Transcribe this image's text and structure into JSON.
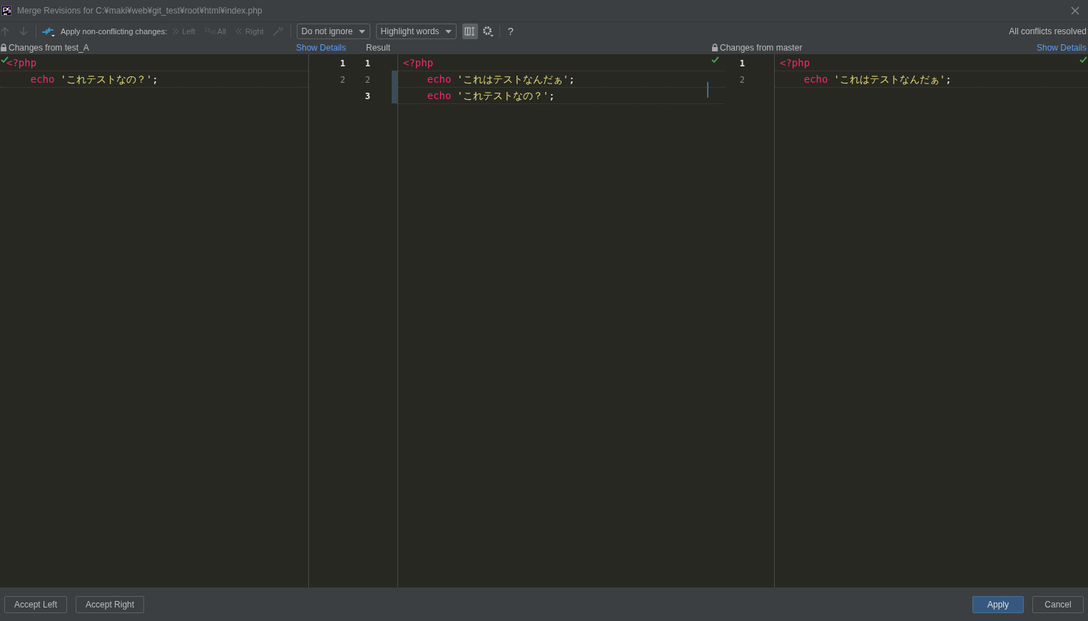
{
  "window": {
    "title": "Merge Revisions for C:¥maki¥web¥git_test¥root¥html¥index.php"
  },
  "toolbar": {
    "nav": [
      {
        "kind": "up",
        "disabled": true
      },
      {
        "kind": "down",
        "disabled": true
      }
    ],
    "apply_label": "Apply non-conflicting changes:",
    "apply_buttons": [
      {
        "kind": "left",
        "label": "Left",
        "disabled": true
      },
      {
        "kind": "all",
        "label": "All",
        "disabled": true
      },
      {
        "kind": "right",
        "label": "Right",
        "disabled": true
      }
    ],
    "dropdowns": [
      "Do not ignore",
      "Highlight words"
    ],
    "sync_scroll": {
      "on": true
    },
    "help": "?",
    "status": "All conflicts resolved"
  },
  "panes": [
    {
      "kind": "side",
      "header": "Changes from test_A",
      "link": "Show Details",
      "resolved": true,
      "line_numbers": [
        {
          "text": "1",
          "current": true
        },
        {
          "text": "2",
          "current": false
        }
      ],
      "lines": [
        {
          "tokens": [
            {
              "kind": "tag",
              "text": "<?php"
            }
          ]
        },
        {
          "tokens": [
            {
              "kind": "keyword",
              "text": "    echo"
            },
            {
              "kind": "string",
              "text": "'これテストなの？'"
            },
            {
              "kind": "punct",
              "text": ";"
            }
          ]
        }
      ]
    },
    {
      "kind": "result",
      "header": "Result",
      "resolved": true,
      "line_numbers": [
        {
          "text": "1",
          "current": true
        },
        {
          "text": "2",
          "current": false
        },
        {
          "text": "3",
          "current": true
        }
      ],
      "lines": [
        {
          "tokens": [
            {
              "kind": "tag",
              "text": "<?php"
            }
          ]
        },
        {
          "tokens": [
            {
              "kind": "keyword",
              "text": "    echo"
            },
            {
              "kind": "string",
              "text": "'これはテストなんだぁ'"
            },
            {
              "kind": "punct",
              "text": ";"
            }
          ]
        },
        {
          "tokens": [
            {
              "kind": "keyword",
              "text": "    echo"
            },
            {
              "kind": "string",
              "text": "'これテストなの？'"
            },
            {
              "kind": "punct",
              "text": ";"
            }
          ]
        }
      ]
    },
    {
      "kind": "side",
      "header": "Changes from master",
      "link": "Show Details",
      "resolved": true,
      "line_numbers": [
        {
          "text": "1",
          "current": true
        },
        {
          "text": "2",
          "current": false
        }
      ],
      "lines": [
        {
          "tokens": [
            {
              "kind": "tag",
              "text": "<?php"
            }
          ]
        },
        {
          "tokens": [
            {
              "kind": "keyword",
              "text": "    echo"
            },
            {
              "kind": "string",
              "text": "'これはテストなんだぁ'"
            },
            {
              "kind": "punct",
              "text": ";"
            }
          ]
        }
      ]
    }
  ],
  "buttons": [
    {
      "label": "Accept Left",
      "primary": false
    },
    {
      "label": "Accept Right",
      "primary": false
    },
    {
      "label": "Apply",
      "primary": true
    },
    {
      "label": "Cancel",
      "primary": false
    }
  ]
}
